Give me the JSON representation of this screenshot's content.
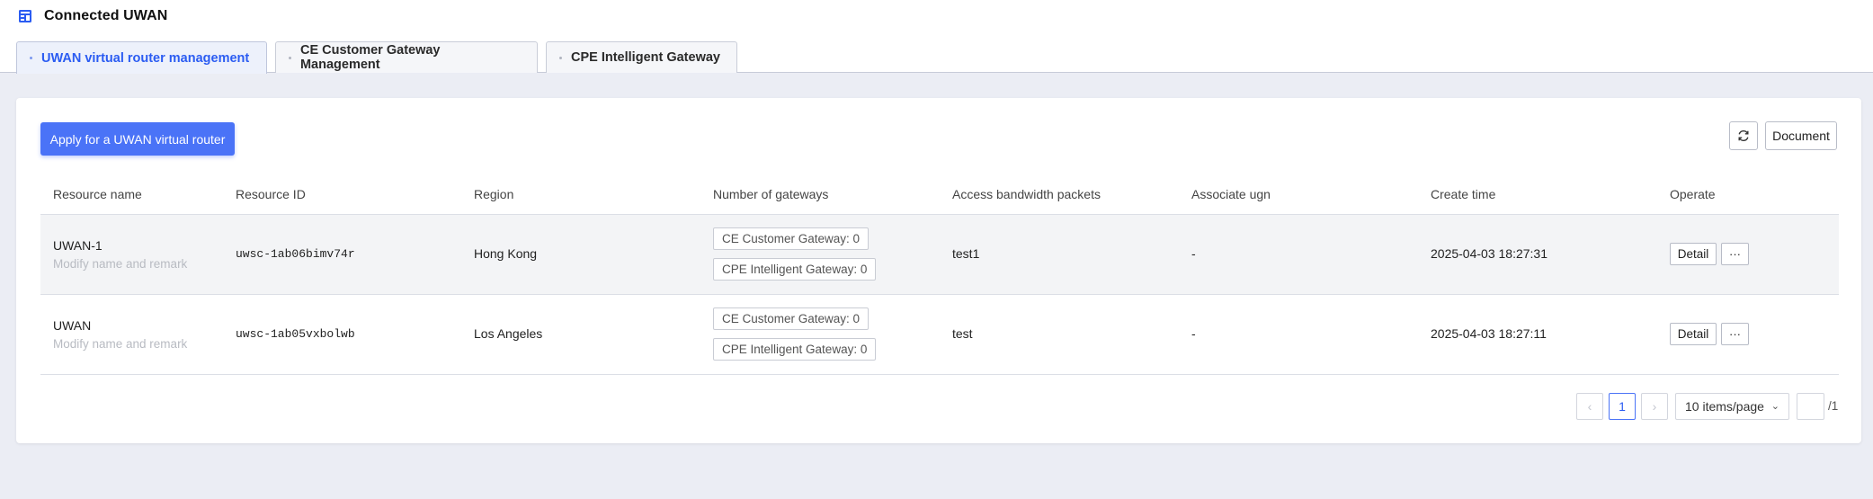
{
  "app": {
    "title": "Connected UWAN",
    "icon": "network-grid-icon",
    "accent": "#2b5cf2"
  },
  "tabs": [
    {
      "label": "UWAN virtual router management",
      "active": true
    },
    {
      "label": "CE Customer Gateway Management",
      "active": false
    },
    {
      "label": "CPE Intelligent Gateway",
      "active": false
    }
  ],
  "toolbar": {
    "apply_label": "Apply for a UWAN virtual router",
    "refresh_icon": "refresh-icon",
    "document_label": "Document"
  },
  "table": {
    "columns": [
      "Resource name",
      "Resource ID",
      "Region",
      "Number of gateways",
      "Access bandwidth packets",
      "Associate ugn",
      "Create time",
      "Operate"
    ],
    "rows": [
      {
        "name": "UWAN-1",
        "remark": "Modify name and remark",
        "id": "uwsc-1ab06bimv74r",
        "region": "Hong Kong",
        "ce_gateways": "CE Customer Gateway: 0",
        "cpe_gateways": "CPE Intelligent Gateway: 0",
        "bandwidth": "test1",
        "ugn": "-",
        "created": "2025-04-03 18:27:31",
        "detail_label": "Detail",
        "more_label": "···"
      },
      {
        "name": "UWAN",
        "remark": "Modify name and remark",
        "id": "uwsc-1ab05vxbolwb",
        "region": "Los Angeles",
        "ce_gateways": "CE Customer Gateway: 0",
        "cpe_gateways": "CPE Intelligent Gateway: 0",
        "bandwidth": "test",
        "ugn": "-",
        "created": "2025-04-03 18:27:11",
        "detail_label": "Detail",
        "more_label": "···"
      }
    ]
  },
  "pagination": {
    "prev_label": "‹",
    "current_page": "1",
    "next_label": "›",
    "page_size": "10 items/page",
    "jump_value": "",
    "total_pages": "/1"
  }
}
